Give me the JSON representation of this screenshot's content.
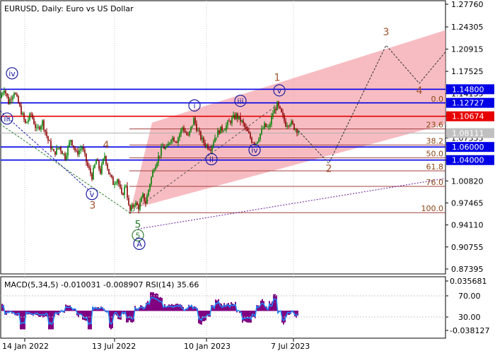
{
  "header": {
    "title": "EURUSD, Daily:  Euro vs US Dollar",
    "indicator": "MACD(5,34,5) -0.010031 -0.008907 RSI(14) 35.66"
  },
  "colors": {
    "grid": "#c8c8c8",
    "blue_line": "#0000e6",
    "red_line": "#e60000",
    "price_box": "#0000e6",
    "red_box": "#e60000",
    "grey_box": "#c0c0c0",
    "channel": "#f4a0a8",
    "fib_line": "#a04040",
    "wave_brown": "#a0522d",
    "wave_blue": "#1a1aa0",
    "wave_green": "#2e7d32",
    "candle_up": "#008000",
    "candle_down": "#8b0000",
    "macd_hist": "#800080",
    "macd_signal": "#1e90ff",
    "frame": "#000000"
  },
  "chart_data": {
    "type": "candlestick",
    "symbol": "EURUSD",
    "timeframe": "Daily",
    "ylim": [
      0.87395,
      1.2776
    ],
    "x_ticks": [
      "14 Jan 2022",
      "13 Jul 2022",
      "10 Jan 2023",
      "7 Jul 2023"
    ],
    "y_ticks": [
      1.2776,
      1.24305,
      1.20915,
      1.17525,
      1.14135,
      1.10745,
      1.08111,
      1.07355,
      1.03965,
      1.0082,
      0.97465,
      0.9411,
      0.90755,
      0.87395
    ],
    "y_tick_labels": [
      "1.27760",
      "1.24305",
      "1.20915",
      "1.17525",
      "1.14135",
      "1.10745",
      "1.07355",
      "1.03965",
      "1.00820",
      "0.97465",
      "0.94110",
      "0.90755",
      "0.87395"
    ],
    "price_levels": [
      {
        "value": 1.148,
        "label": "1.14800",
        "color": "blue"
      },
      {
        "value": 1.12727,
        "label": "1.12727",
        "color": "blue"
      },
      {
        "value": 1.10674,
        "label": "1.10674",
        "color": "red"
      },
      {
        "value": 1.08111,
        "label": "1.08111",
        "color": "grey"
      },
      {
        "value": 1.06,
        "label": "1.06000",
        "color": "blue"
      },
      {
        "value": 1.04,
        "label": "1.04000",
        "color": "blue"
      }
    ],
    "fib_levels": [
      {
        "label": "0.0",
        "value": 1.127
      },
      {
        "label": "23.6",
        "value": 1.0875
      },
      {
        "label": "38.2",
        "value": 1.063
      },
      {
        "label": "50.0",
        "value": 1.0433
      },
      {
        "label": "61.8",
        "value": 1.0236
      },
      {
        "label": "76.0",
        "value": 0.9999
      },
      {
        "label": "100.0",
        "value": 0.9598
      }
    ],
    "price_path": [
      [
        0,
        1.135
      ],
      [
        6,
        1.15
      ],
      [
        12,
        1.128
      ],
      [
        20,
        1.145
      ],
      [
        28,
        1.12
      ],
      [
        36,
        1.095
      ],
      [
        44,
        1.11
      ],
      [
        52,
        1.085
      ],
      [
        60,
        1.098
      ],
      [
        68,
        1.07
      ],
      [
        76,
        1.05
      ],
      [
        84,
        1.06
      ],
      [
        92,
        1.045
      ],
      [
        100,
        1.072
      ],
      [
        108,
        1.05
      ],
      [
        116,
        1.06
      ],
      [
        124,
        1.03
      ],
      [
        130,
        1.015
      ],
      [
        136,
        1.04
      ],
      [
        142,
        1.022
      ],
      [
        148,
        1.047
      ],
      [
        154,
        1.02
      ],
      [
        160,
        1.005
      ],
      [
        166,
        1.012
      ],
      [
        172,
        0.985
      ],
      [
        178,
        1.003
      ],
      [
        183,
        0.96
      ],
      [
        190,
        0.975
      ],
      [
        196,
        0.968
      ],
      [
        202,
        0.985
      ],
      [
        206,
        0.975
      ],
      [
        212,
        1.005
      ],
      [
        218,
        1.03
      ],
      [
        224,
        1.045
      ],
      [
        230,
        1.06
      ],
      [
        236,
        1.057
      ],
      [
        242,
        1.075
      ],
      [
        250,
        1.07
      ],
      [
        258,
        1.09
      ],
      [
        266,
        1.075
      ],
      [
        274,
        1.102
      ],
      [
        280,
        1.083
      ],
      [
        286,
        1.07
      ],
      [
        292,
        1.062
      ],
      [
        298,
        1.059
      ],
      [
        304,
        1.075
      ],
      [
        310,
        1.085
      ],
      [
        318,
        1.09
      ],
      [
        326,
        1.1
      ],
      [
        334,
        1.108
      ],
      [
        342,
        1.098
      ],
      [
        350,
        1.082
      ],
      [
        356,
        1.07
      ],
      [
        362,
        1.067
      ],
      [
        368,
        1.08
      ],
      [
        374,
        1.092
      ],
      [
        380,
        1.088
      ],
      [
        386,
        1.112
      ],
      [
        392,
        1.124
      ],
      [
        398,
        1.11
      ],
      [
        404,
        1.095
      ],
      [
        410,
        1.098
      ],
      [
        416,
        1.09
      ],
      [
        422,
        1.085
      ]
    ],
    "wave_labels": [
      {
        "text": "iv",
        "x": 17,
        "value": 1.168,
        "style": "circle-blue"
      },
      {
        "text": "iii",
        "x": 10,
        "value": 1.099,
        "style": "circle-blue"
      },
      {
        "text": "4",
        "x": 150,
        "value": 1.058,
        "style": "brown"
      },
      {
        "text": "v",
        "x": 130,
        "value": 0.984,
        "style": "circle-blue"
      },
      {
        "text": "3",
        "x": 131,
        "value": 0.966,
        "style": "brown"
      },
      {
        "text": "5",
        "x": 195,
        "value": 0.937,
        "style": "green"
      },
      {
        "text": "5",
        "x": 195,
        "value": 0.921,
        "style": "circle-green"
      },
      {
        "text": "A",
        "x": 197,
        "value": 0.908,
        "style": "circle-blue"
      },
      {
        "text": "i",
        "x": 275,
        "value": 1.119,
        "style": "circle-blue"
      },
      {
        "text": "ii",
        "x": 299,
        "value": 1.037,
        "style": "circle-blue"
      },
      {
        "text": "iii",
        "x": 340,
        "value": 1.126,
        "style": "circle-blue"
      },
      {
        "text": "iv",
        "x": 360,
        "value": 1.051,
        "style": "circle-blue"
      },
      {
        "text": "1",
        "x": 392,
        "value": 1.161,
        "style": "brown"
      },
      {
        "text": "v",
        "x": 395,
        "value": 1.142,
        "style": "circle-blue"
      },
      {
        "text": "2",
        "x": 465,
        "value": 1.022,
        "style": "brown"
      },
      {
        "text": "3",
        "x": 546,
        "value": 1.23,
        "style": "brown"
      },
      {
        "text": "4",
        "x": 593,
        "value": 1.141,
        "style": "brown"
      }
    ],
    "forecast_path": [
      [
        422,
        1.085
      ],
      [
        465,
        1.035
      ],
      [
        546,
        1.215
      ],
      [
        593,
        1.157
      ],
      [
        630,
        1.205
      ]
    ],
    "channel": {
      "upper": [
        [
          215,
          1.097
        ],
        [
          630,
          1.238
        ]
      ],
      "lower": [
        [
          185,
          0.965
        ],
        [
          630,
          1.095
        ]
      ]
    },
    "rsi": {
      "y_ticks": [
        0.035681,
        -0.038127
      ],
      "y_tick_labels": [
        "0.035681",
        "-0.038127"
      ],
      "levels": [
        "70.00",
        "30.00"
      ]
    }
  }
}
